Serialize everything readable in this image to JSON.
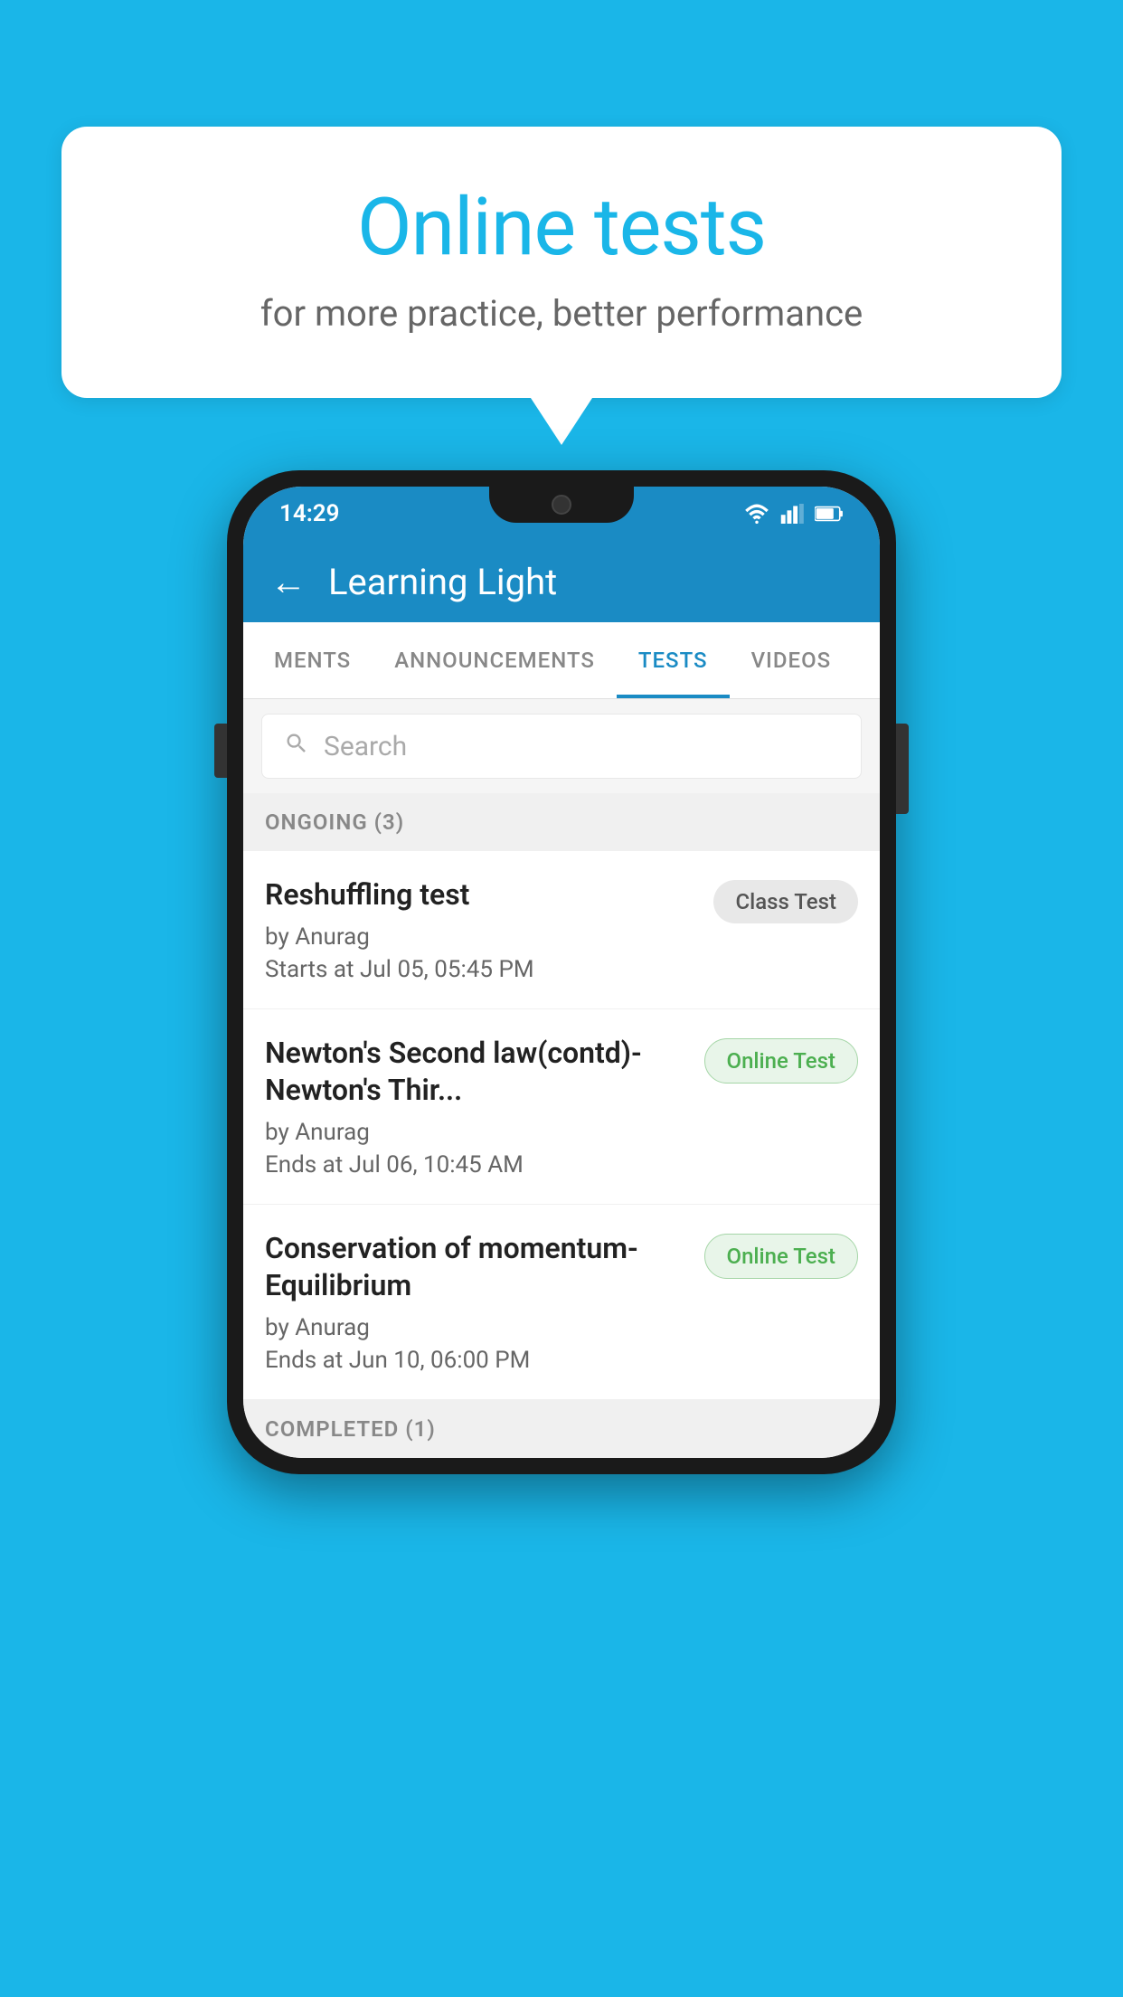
{
  "background_color": "#1ab6e8",
  "bubble": {
    "title": "Online tests",
    "subtitle": "for more practice, better performance"
  },
  "phone": {
    "status_bar": {
      "time": "14:29"
    },
    "app_bar": {
      "back_icon": "←",
      "title": "Learning Light"
    },
    "tabs": [
      {
        "label": "MENTS",
        "active": false
      },
      {
        "label": "ANNOUNCEMENTS",
        "active": false
      },
      {
        "label": "TESTS",
        "active": true
      },
      {
        "label": "VIDEOS",
        "active": false
      }
    ],
    "search": {
      "placeholder": "Search"
    },
    "ongoing_section": {
      "label": "ONGOING (3)"
    },
    "tests": [
      {
        "title": "Reshuffling test",
        "author": "by Anurag",
        "date": "Starts at  Jul 05, 05:45 PM",
        "badge": "Class Test",
        "badge_type": "class"
      },
      {
        "title": "Newton's Second law(contd)-Newton's Thir...",
        "author": "by Anurag",
        "date": "Ends at  Jul 06, 10:45 AM",
        "badge": "Online Test",
        "badge_type": "online"
      },
      {
        "title": "Conservation of momentum-Equilibrium",
        "author": "by Anurag",
        "date": "Ends at  Jun 10, 06:00 PM",
        "badge": "Online Test",
        "badge_type": "online"
      }
    ],
    "completed_section": {
      "label": "COMPLETED (1)"
    }
  }
}
